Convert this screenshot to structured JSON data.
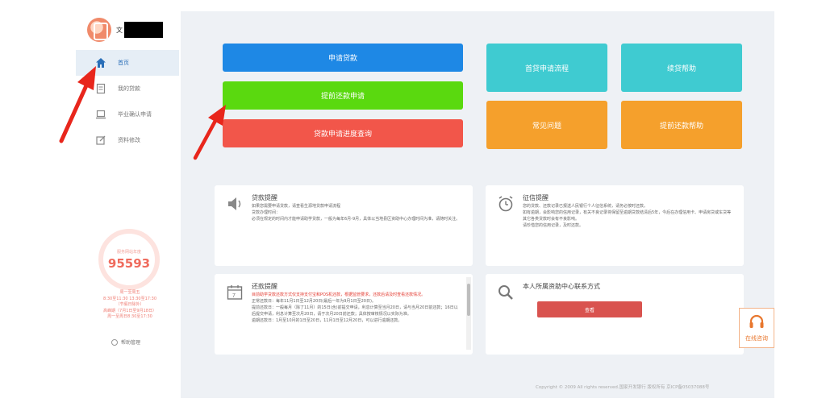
{
  "user": {
    "name_prefix": "文"
  },
  "sidebar": {
    "items": [
      {
        "label": "首页",
        "icon": "home-icon",
        "active": true
      },
      {
        "label": "我的贷款",
        "icon": "document-icon",
        "active": false
      },
      {
        "label": "毕业确认申请",
        "icon": "laptop-icon",
        "active": false
      },
      {
        "label": "资料修改",
        "icon": "edit-icon",
        "active": false
      }
    ],
    "visits_label": "服务网站年度",
    "visits_count": "95593",
    "hours": [
      "周一至周五",
      "8:30至11:30 13:30至17:30",
      "（节假日除外）",
      "高峰期（7月1日至9月18日）",
      "周一至周日8:30至17:30"
    ],
    "help_label": "帮助管理"
  },
  "buttons": {
    "apply_loan": "申请贷款",
    "early_repay": "提前还款申请",
    "progress": "贷款申请进度查询",
    "first_process": "首贷申请流程",
    "renew_help": "续贷帮助",
    "faq": "常见问题",
    "early_repay_help": "提前还款帮助"
  },
  "cards": {
    "loan_notice": {
      "title": "贷款提醒",
      "body": [
        "如果您需要申请贷款，请查看生源地贷款申请流程",
        "贷款办理时间：",
        "必须在规定的时间内才能申请助学贷款，一般为每年6月-9月，具体以当地县区资助中心办理时间为准，请随时关注。"
      ]
    },
    "credit_notice": {
      "title": "征信提醒",
      "body": [
        "您的贷款、还款记录已报送人民银行个人征信系统，请务必按时还款。",
        "如有逾期，会影响您的信用记录，有关不良记录将保留至逾期贷款结清后5年，今后在办理信用卡、申请房贷或车贷等其它各类贷款时会有不良影响。",
        "请珍惜您的信用记录，及时还款。"
      ]
    },
    "repay_notice": {
      "title": "还款提醒",
      "highlight": "目前助学贷款还款方式仅支持支付宝和POS机还款，根据监管要求，还款后请及时查看还款情况。",
      "body": [
        "正常还款日：每年11月1日至12月20日(最后一年为9月1日至20日)。",
        "提前还款日：一般每月（除了11月）的15日(含)前提交申请，利息计算至当月20日，请与当月20日前还款；16日以后提交申请，利息计算至次月20日，请于次月20日前还款；具体按审核情况以实际为准。",
        "逾期还款日：1月至10月的1日至20日，11月1日至12月20日，可以进行逾期还款。"
      ]
    },
    "contact": {
      "title": "本人所属资助中心联系方式",
      "button": "查看"
    }
  },
  "footer": "Copyright © 2009 All rights reserved.国家开发银行 版权所有 京ICP备05037088号",
  "consult_label": "在线咨询",
  "colors": {
    "blue": "#1e88e5",
    "green": "#5ad90f",
    "red": "#f2564a",
    "teal": "#3fcbd1",
    "orange": "#f5a02c",
    "arrow": "#e8261c"
  }
}
